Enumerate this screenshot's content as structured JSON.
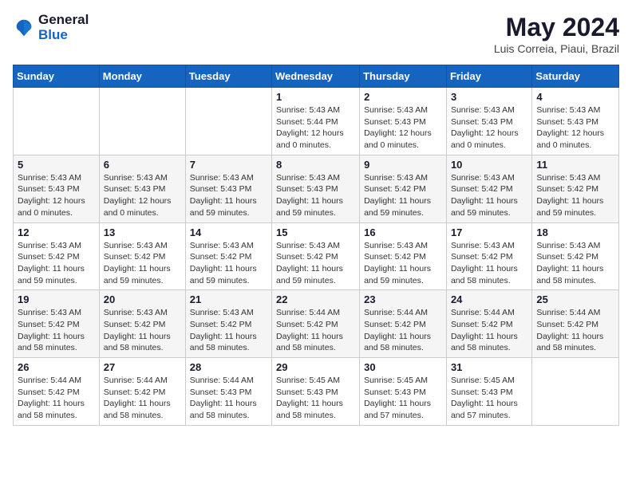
{
  "header": {
    "logo_line1": "General",
    "logo_line2": "Blue",
    "month": "May 2024",
    "location": "Luis Correia, Piaui, Brazil"
  },
  "weekdays": [
    "Sunday",
    "Monday",
    "Tuesday",
    "Wednesday",
    "Thursday",
    "Friday",
    "Saturday"
  ],
  "weeks": [
    [
      {
        "day": "",
        "info": ""
      },
      {
        "day": "",
        "info": ""
      },
      {
        "day": "",
        "info": ""
      },
      {
        "day": "1",
        "info": "Sunrise: 5:43 AM\nSunset: 5:44 PM\nDaylight: 12 hours\nand 0 minutes."
      },
      {
        "day": "2",
        "info": "Sunrise: 5:43 AM\nSunset: 5:43 PM\nDaylight: 12 hours\nand 0 minutes."
      },
      {
        "day": "3",
        "info": "Sunrise: 5:43 AM\nSunset: 5:43 PM\nDaylight: 12 hours\nand 0 minutes."
      },
      {
        "day": "4",
        "info": "Sunrise: 5:43 AM\nSunset: 5:43 PM\nDaylight: 12 hours\nand 0 minutes."
      }
    ],
    [
      {
        "day": "5",
        "info": "Sunrise: 5:43 AM\nSunset: 5:43 PM\nDaylight: 12 hours\nand 0 minutes."
      },
      {
        "day": "6",
        "info": "Sunrise: 5:43 AM\nSunset: 5:43 PM\nDaylight: 12 hours\nand 0 minutes."
      },
      {
        "day": "7",
        "info": "Sunrise: 5:43 AM\nSunset: 5:43 PM\nDaylight: 11 hours\nand 59 minutes."
      },
      {
        "day": "8",
        "info": "Sunrise: 5:43 AM\nSunset: 5:43 PM\nDaylight: 11 hours\nand 59 minutes."
      },
      {
        "day": "9",
        "info": "Sunrise: 5:43 AM\nSunset: 5:42 PM\nDaylight: 11 hours\nand 59 minutes."
      },
      {
        "day": "10",
        "info": "Sunrise: 5:43 AM\nSunset: 5:42 PM\nDaylight: 11 hours\nand 59 minutes."
      },
      {
        "day": "11",
        "info": "Sunrise: 5:43 AM\nSunset: 5:42 PM\nDaylight: 11 hours\nand 59 minutes."
      }
    ],
    [
      {
        "day": "12",
        "info": "Sunrise: 5:43 AM\nSunset: 5:42 PM\nDaylight: 11 hours\nand 59 minutes."
      },
      {
        "day": "13",
        "info": "Sunrise: 5:43 AM\nSunset: 5:42 PM\nDaylight: 11 hours\nand 59 minutes."
      },
      {
        "day": "14",
        "info": "Sunrise: 5:43 AM\nSunset: 5:42 PM\nDaylight: 11 hours\nand 59 minutes."
      },
      {
        "day": "15",
        "info": "Sunrise: 5:43 AM\nSunset: 5:42 PM\nDaylight: 11 hours\nand 59 minutes."
      },
      {
        "day": "16",
        "info": "Sunrise: 5:43 AM\nSunset: 5:42 PM\nDaylight: 11 hours\nand 59 minutes."
      },
      {
        "day": "17",
        "info": "Sunrise: 5:43 AM\nSunset: 5:42 PM\nDaylight: 11 hours\nand 58 minutes."
      },
      {
        "day": "18",
        "info": "Sunrise: 5:43 AM\nSunset: 5:42 PM\nDaylight: 11 hours\nand 58 minutes."
      }
    ],
    [
      {
        "day": "19",
        "info": "Sunrise: 5:43 AM\nSunset: 5:42 PM\nDaylight: 11 hours\nand 58 minutes."
      },
      {
        "day": "20",
        "info": "Sunrise: 5:43 AM\nSunset: 5:42 PM\nDaylight: 11 hours\nand 58 minutes."
      },
      {
        "day": "21",
        "info": "Sunrise: 5:43 AM\nSunset: 5:42 PM\nDaylight: 11 hours\nand 58 minutes."
      },
      {
        "day": "22",
        "info": "Sunrise: 5:44 AM\nSunset: 5:42 PM\nDaylight: 11 hours\nand 58 minutes."
      },
      {
        "day": "23",
        "info": "Sunrise: 5:44 AM\nSunset: 5:42 PM\nDaylight: 11 hours\nand 58 minutes."
      },
      {
        "day": "24",
        "info": "Sunrise: 5:44 AM\nSunset: 5:42 PM\nDaylight: 11 hours\nand 58 minutes."
      },
      {
        "day": "25",
        "info": "Sunrise: 5:44 AM\nSunset: 5:42 PM\nDaylight: 11 hours\nand 58 minutes."
      }
    ],
    [
      {
        "day": "26",
        "info": "Sunrise: 5:44 AM\nSunset: 5:42 PM\nDaylight: 11 hours\nand 58 minutes."
      },
      {
        "day": "27",
        "info": "Sunrise: 5:44 AM\nSunset: 5:42 PM\nDaylight: 11 hours\nand 58 minutes."
      },
      {
        "day": "28",
        "info": "Sunrise: 5:44 AM\nSunset: 5:43 PM\nDaylight: 11 hours\nand 58 minutes."
      },
      {
        "day": "29",
        "info": "Sunrise: 5:45 AM\nSunset: 5:43 PM\nDaylight: 11 hours\nand 58 minutes."
      },
      {
        "day": "30",
        "info": "Sunrise: 5:45 AM\nSunset: 5:43 PM\nDaylight: 11 hours\nand 57 minutes."
      },
      {
        "day": "31",
        "info": "Sunrise: 5:45 AM\nSunset: 5:43 PM\nDaylight: 11 hours\nand 57 minutes."
      },
      {
        "day": "",
        "info": ""
      }
    ]
  ]
}
